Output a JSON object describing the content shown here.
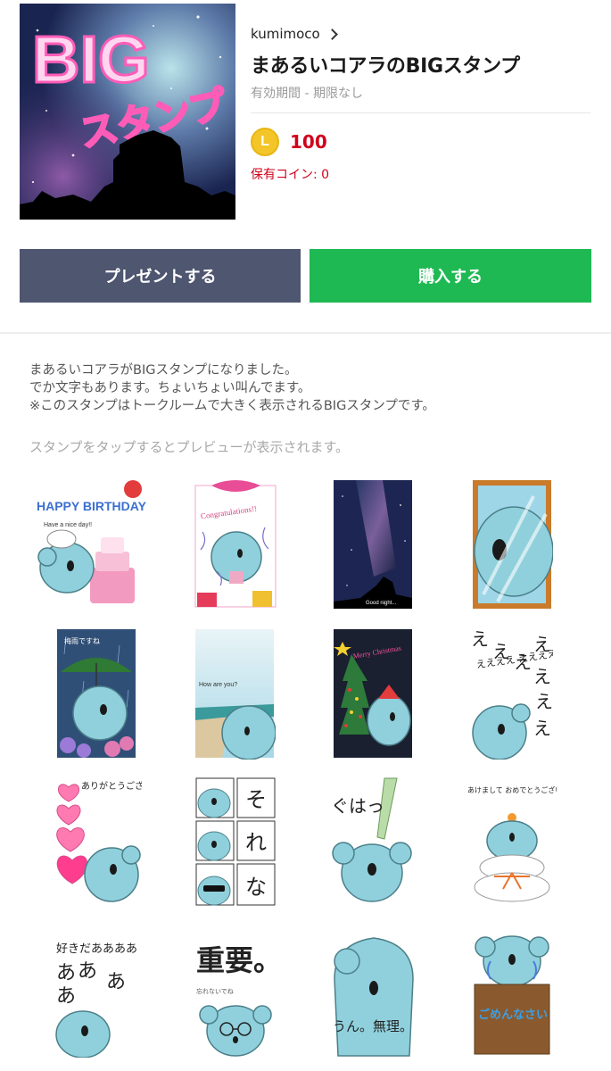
{
  "product": {
    "author": "kumimoco",
    "title": "まあるいコアラのBIGスタンプ",
    "validity": "有効期間 - 期限なし",
    "price": "100",
    "coin_symbol": "L",
    "owned_coins": "保有コイン: 0",
    "thumbnail_text_line1": "BIG",
    "thumbnail_text_line2": "スタンプ"
  },
  "actions": {
    "gift_label": "プレゼントする",
    "buy_label": "購入する"
  },
  "description": {
    "line1": "まあるいコアラがBIGスタンプになりました。",
    "line2": "でか文字もあります。ちょいちょい叫んでます。",
    "line3": "※このスタンプはトークルームで大きく表示されるBIGスタンプです。"
  },
  "preview_hint": "スタンプをタップするとプレビューが表示されます。",
  "stickers": [
    {
      "id": "happy-birthday",
      "text": "HAPPY BIRTHDAY",
      "subtext": "Have a nice day!!"
    },
    {
      "id": "congratulations",
      "text": "Congratulations!!"
    },
    {
      "id": "good-night",
      "text": "Good night..."
    },
    {
      "id": "window",
      "text": ""
    },
    {
      "id": "rainy",
      "text": "梅雨ですね"
    },
    {
      "id": "how-are-you",
      "text": "How are you?"
    },
    {
      "id": "merry-christmas",
      "text": "Merry Christmas"
    },
    {
      "id": "eee",
      "text": "ええええ ええええ ええ!?"
    },
    {
      "id": "arigatou",
      "text": "ありがとうございます"
    },
    {
      "id": "sore-na",
      "col1": "そ",
      "col2": "れ",
      "col3": "な"
    },
    {
      "id": "guha",
      "text": "ぐはっ"
    },
    {
      "id": "akeome",
      "text": "あけまして おめでとうございます"
    },
    {
      "id": "sukidaaa",
      "text": "好きだああああ"
    },
    {
      "id": "juuyou",
      "text": "重要。",
      "subtext": "忘れないでね"
    },
    {
      "id": "un-muri",
      "text": "うん。無理。"
    },
    {
      "id": "gomennasai",
      "text": "ごめんなさい"
    }
  ],
  "colors": {
    "buy_green": "#1fb953",
    "gift_slate": "#4e5670",
    "price_red": "#d0021b",
    "coin_gold": "#f4c528",
    "koala_blue": "#8fd0dc"
  }
}
